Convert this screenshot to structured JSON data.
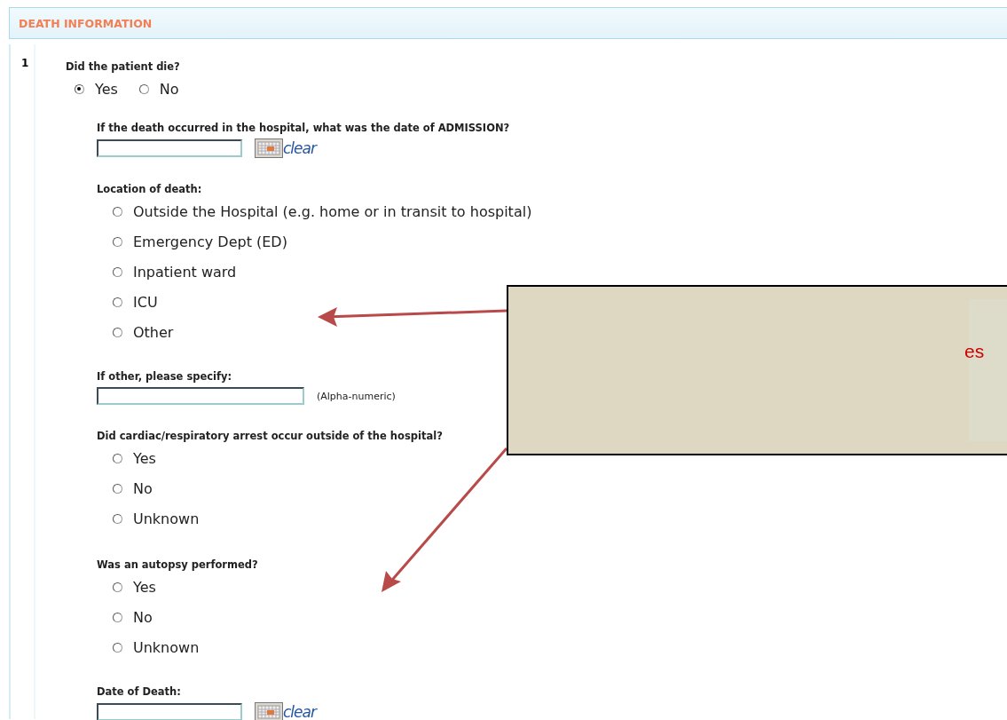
{
  "section_title": "DEATH INFORMATION",
  "question_number": "1",
  "main_question": {
    "label": "Did the patient die?",
    "options": [
      {
        "label": "Yes",
        "selected": true
      },
      {
        "label": "No",
        "selected": false
      }
    ]
  },
  "items": [
    {
      "kind": "date",
      "label": "If the death occurred in the hospital, what was the date of ADMISSION?",
      "action": "clear"
    },
    {
      "kind": "radio",
      "label": "Location of death:",
      "options": [
        {
          "label": "Outside the Hospital (e.g. home or in transit to hospital)",
          "selected": false
        },
        {
          "label": "Emergency Dept (ED)",
          "selected": false
        },
        {
          "label": "Inpatient ward",
          "selected": false
        },
        {
          "label": "ICU",
          "selected": false
        },
        {
          "label": "Other",
          "selected": false
        }
      ]
    },
    {
      "kind": "text",
      "label": "If other, please specify:",
      "hint": "(Alpha-numeric)"
    },
    {
      "kind": "radio",
      "label": "Did cardiac/respiratory arrest occur outside of the hospital?",
      "options": [
        {
          "label": "Yes",
          "selected": false
        },
        {
          "label": "No",
          "selected": false
        },
        {
          "label": "Unknown",
          "selected": false
        }
      ]
    },
    {
      "kind": "radio",
      "label": "Was an autopsy performed?",
      "options": [
        {
          "label": "Yes",
          "selected": false
        },
        {
          "label": "No",
          "selected": false
        },
        {
          "label": "Unknown",
          "selected": false
        }
      ]
    },
    {
      "kind": "date",
      "label": "Date of Death:",
      "action": "clear"
    }
  ],
  "callout": {
    "text": "es"
  }
}
